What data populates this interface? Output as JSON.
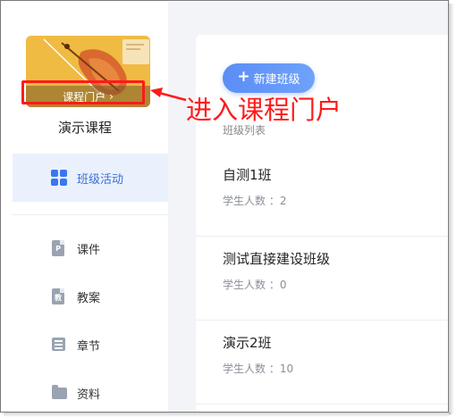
{
  "sidebar": {
    "portal_label": "课程门户",
    "portal_chevron": "›",
    "course_title": "演示课程",
    "active_item": {
      "label": "班级活动",
      "icon": "grid-icon"
    },
    "items": [
      {
        "label": "课件",
        "icon": "file-p-icon",
        "glyph": "P"
      },
      {
        "label": "教案",
        "icon": "file-jiao-icon",
        "glyph": "教"
      },
      {
        "label": "章节",
        "icon": "list-icon"
      },
      {
        "label": "资料",
        "icon": "folder-icon"
      }
    ]
  },
  "main": {
    "new_class_button": "新建班级",
    "new_class_plus": "+",
    "list_title": "班级列表",
    "classes": [
      {
        "name": "自测1班",
        "students": "学生人数 ：2"
      },
      {
        "name": "测试直接建设班级",
        "students": "学生人数 ：0"
      },
      {
        "name": "演示2班",
        "students": "学生人数 ：10"
      }
    ]
  },
  "annotation": {
    "text": "进入课程门户",
    "color": "#ff1a1a"
  },
  "colors": {
    "accent": "#3a76f0",
    "active_bg": "#eaf1fd",
    "annotation": "#ff1a1a"
  }
}
